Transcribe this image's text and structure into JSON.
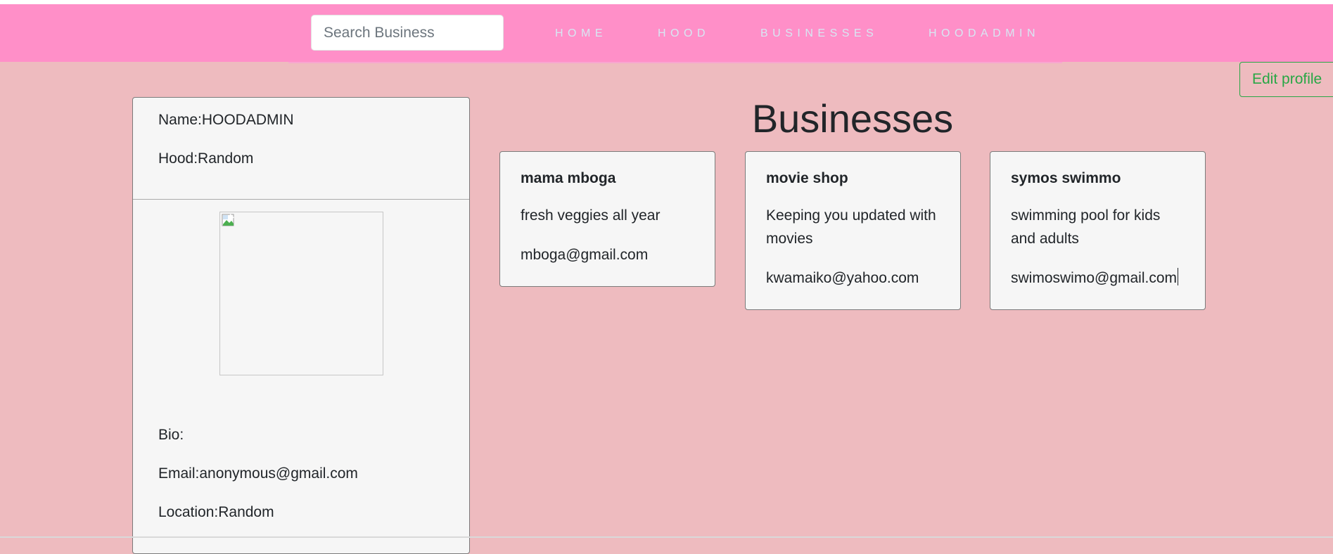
{
  "navbar": {
    "search_placeholder": "Search Business",
    "links": [
      {
        "label": "HOME"
      },
      {
        "label": "HOOD"
      },
      {
        "label": "BUSINESSES"
      },
      {
        "label": "HOODADMIN"
      }
    ]
  },
  "edit_profile_label": "Edit profile",
  "profile": {
    "name_line": "Name:HOODADMIN",
    "hood_line": "Hood:Random",
    "bio_line": "Bio:",
    "email_line": "Email:anonymous@gmail.com",
    "location_line": "Location:Random",
    "image_icon": "broken-image-icon"
  },
  "businesses": {
    "title": "Businesses",
    "items": [
      {
        "name": "mama mboga",
        "description": "fresh veggies all year",
        "email": "mboga@gmail.com"
      },
      {
        "name": "movie shop",
        "description": "Keeping you updated with movies",
        "email": "kwamaiko@yahoo.com"
      },
      {
        "name": "symos swimmo",
        "description": "swimming pool for kids and adults",
        "email": "swimoswimo@gmail.com"
      }
    ]
  },
  "colors": {
    "page_background": "#eebbbf",
    "navbar_background": "#ff8fc8",
    "nav_link": "#d7e7f3",
    "edit_button": "#28a745",
    "card_background": "#f6f6f6"
  }
}
